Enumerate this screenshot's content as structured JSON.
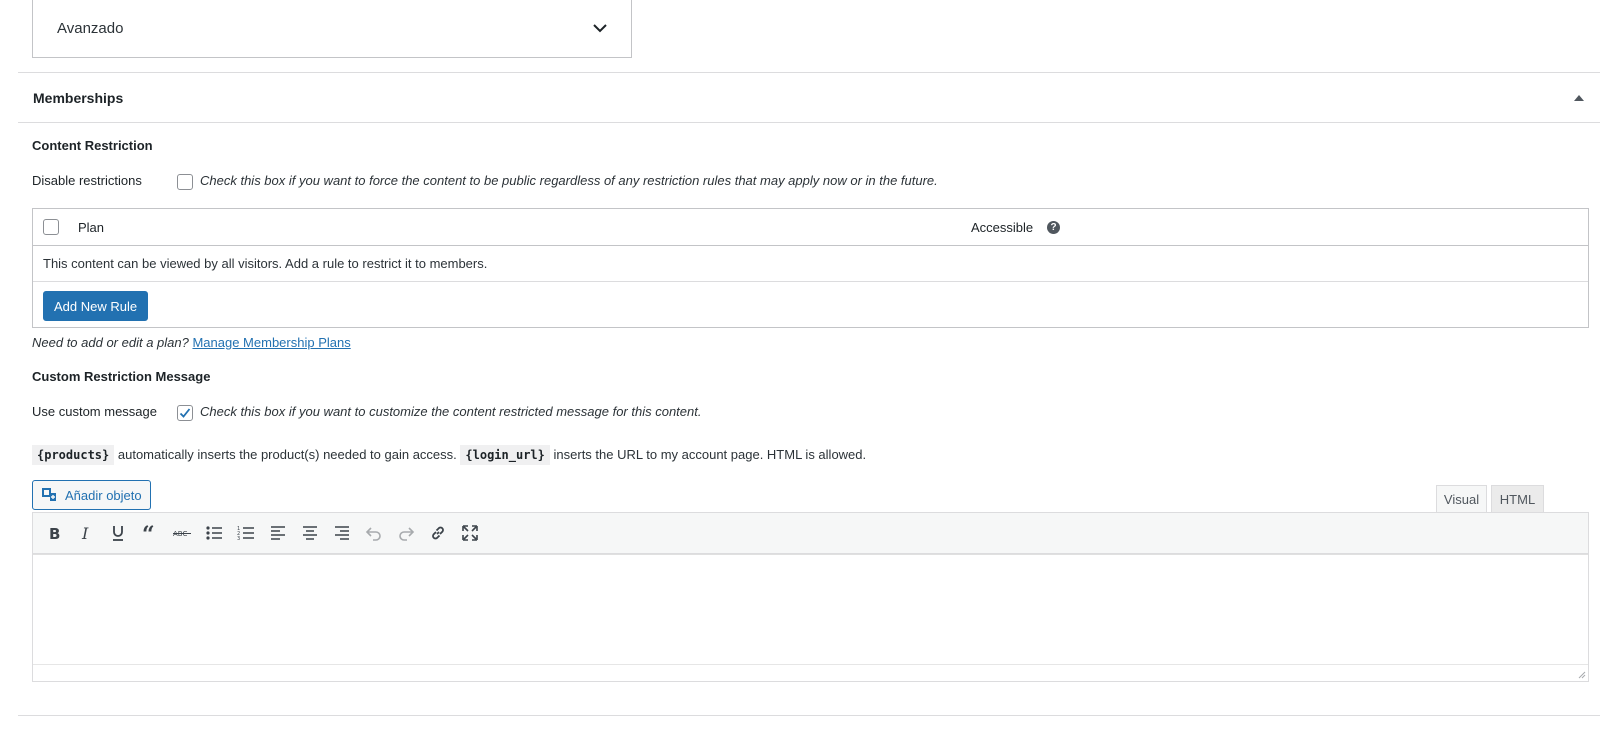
{
  "select": {
    "value": "Avanzado"
  },
  "metabox": {
    "title": "Memberships",
    "content_restriction": {
      "title": "Content Restriction",
      "disable_label": "Disable restrictions",
      "disable_desc": "Check this box if you want to force the content to be public regardless of any restriction rules that may apply now or in the future.",
      "disable_checked": false,
      "table": {
        "col_plan": "Plan",
        "col_accessible": "Accessible",
        "empty_message": "This content can be viewed by all visitors. Add a rule to restrict it to members.",
        "add_rule_label": "Add New Rule"
      },
      "manage_prefix": "Need to add or edit a plan?",
      "manage_link": "Manage Membership Plans"
    },
    "custom_message": {
      "title": "Custom Restriction Message",
      "use_label": "Use custom message",
      "use_desc": "Check this box if you want to customize the content restricted message for this content.",
      "use_checked": true,
      "code_products": "{products}",
      "text_products": "automatically inserts the product(s) needed to gain access.",
      "code_login": "{login_url}",
      "text_login": "inserts the URL to my account page. HTML is allowed.",
      "add_media_label": "Añadir objeto",
      "tab_visual": "Visual",
      "tab_html": "HTML"
    }
  },
  "toolbar": [
    "bold-icon",
    "italic-icon",
    "underline-icon",
    "blockquote-icon",
    "strikethrough-icon",
    "bullet-list-icon",
    "numbered-list-icon",
    "align-left-icon",
    "align-center-icon",
    "align-right-icon",
    "undo-icon",
    "redo-icon",
    "link-icon",
    "fullscreen-icon"
  ],
  "colors": {
    "primary": "#2271b1",
    "border": "#c3c4c7",
    "text": "#1d2327"
  }
}
